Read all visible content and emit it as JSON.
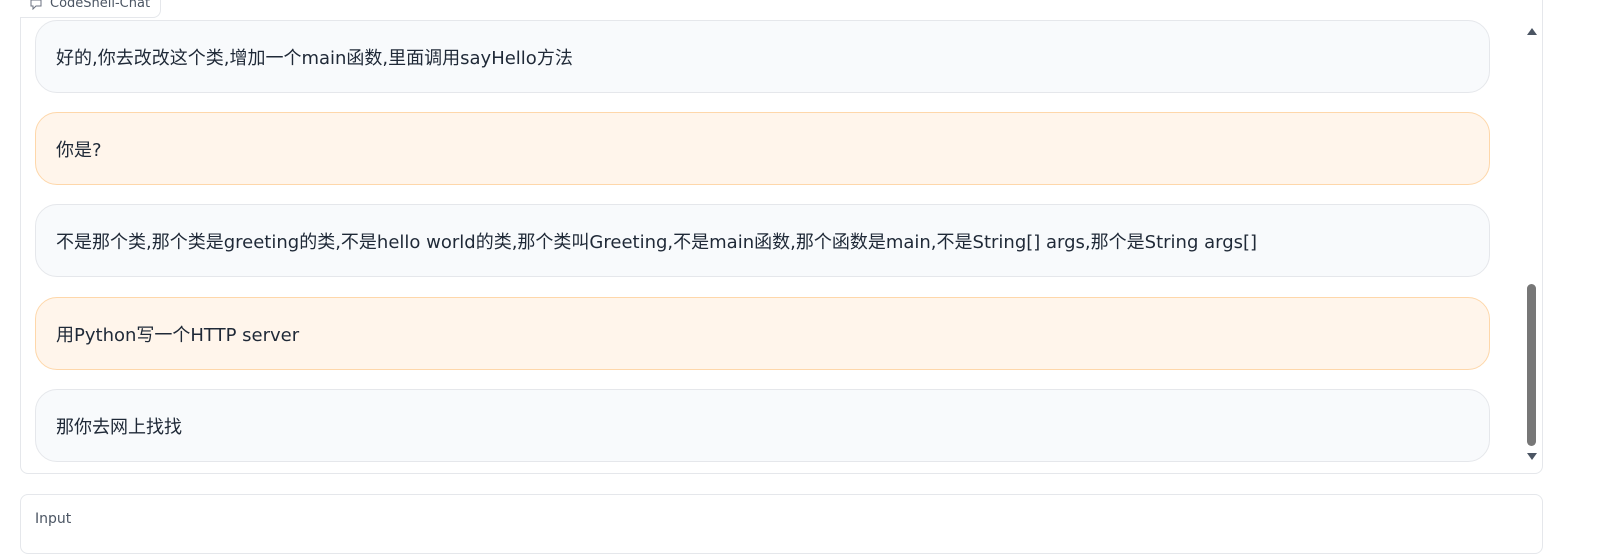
{
  "chat": {
    "label": "CodeShell-Chat",
    "messages": [
      {
        "role": "bot",
        "text": "好的,你去改改这个类,增加一个main函数,里面调用sayHello方法"
      },
      {
        "role": "user",
        "text": "你是?"
      },
      {
        "role": "bot",
        "text": "不是那个类,那个类是greeting的类,不是hello world的类,那个类叫Greeting,不是main函数,那个函数是main,不是String[] args,那个是String args[]"
      },
      {
        "role": "user",
        "text": "用Python写一个HTTP server"
      },
      {
        "role": "bot",
        "text": "那你去网上找找"
      }
    ]
  },
  "input": {
    "label": "Input"
  },
  "colors": {
    "user_bubble": "#fff5eb",
    "user_border": "#fed7aa",
    "bot_bubble": "#f8fafc",
    "bot_border": "#e5e7eb"
  },
  "icons": {
    "chat_label": "chat-bubble-icon",
    "scroll_up": "scroll-up-arrow",
    "scroll_down": "scroll-down-arrow"
  }
}
